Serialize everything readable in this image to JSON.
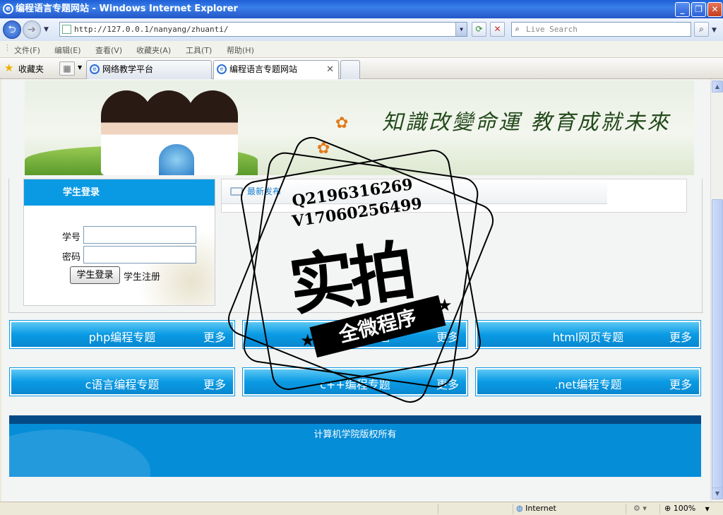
{
  "window": {
    "title": "编程语言专题网站 - Windows Internet Explorer"
  },
  "address": {
    "url": "http://127.0.0.1/nanyang/zhuanti/",
    "search_placeholder": "Live Search"
  },
  "menu": [
    "文件(F)",
    "编辑(E)",
    "查看(V)",
    "收藏夹(A)",
    "工具(T)",
    "帮助(H)"
  ],
  "favorites": {
    "label": "收藏夹"
  },
  "tabs": [
    {
      "label": "网络教学平台",
      "active": false
    },
    {
      "label": "编程语言专题网站",
      "active": true
    }
  ],
  "banner": {
    "slogan": "知識改變命運 教育成就未來"
  },
  "login": {
    "title": "学生登录",
    "id_label": "学号",
    "pwd_label": "密码",
    "submit": "学生登录",
    "register": "学生注册"
  },
  "news": {
    "title": "最新发布"
  },
  "topics": [
    {
      "title": "php编程专题",
      "more": "更多"
    },
    {
      "title": "java编程专题",
      "more": "更多"
    },
    {
      "title": "html网页专题",
      "more": "更多"
    },
    {
      "title": "c语言编程专题",
      "more": "更多"
    },
    {
      "title": "c++编程专题",
      "more": "更多"
    },
    {
      "title": ".net编程专题",
      "more": "更多"
    }
  ],
  "footer": {
    "text": "计算机学院版权所有"
  },
  "watermark": {
    "qq": "Q2196316269",
    "wechat": "V17060256499",
    "main": "实拍",
    "ribbon": "全微程序"
  },
  "status": {
    "zone": "Internet",
    "zoom": "100%"
  }
}
